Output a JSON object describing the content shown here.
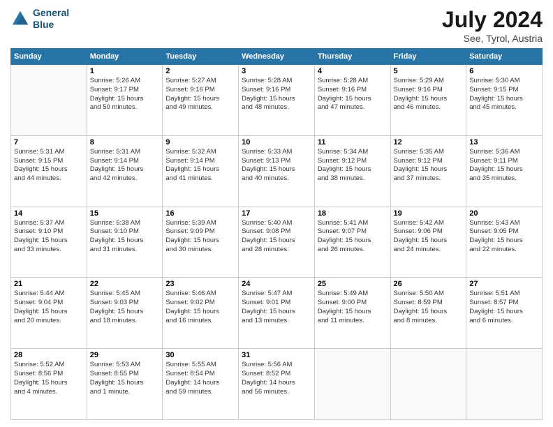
{
  "logo": {
    "line1": "General",
    "line2": "Blue"
  },
  "title": "July 2024",
  "subtitle": "See, Tyrol, Austria",
  "days_of_week": [
    "Sunday",
    "Monday",
    "Tuesday",
    "Wednesday",
    "Thursday",
    "Friday",
    "Saturday"
  ],
  "weeks": [
    [
      {
        "day": null,
        "info": null
      },
      {
        "day": "1",
        "info": "Sunrise: 5:26 AM\nSunset: 9:17 PM\nDaylight: 15 hours\nand 50 minutes."
      },
      {
        "day": "2",
        "info": "Sunrise: 5:27 AM\nSunset: 9:16 PM\nDaylight: 15 hours\nand 49 minutes."
      },
      {
        "day": "3",
        "info": "Sunrise: 5:28 AM\nSunset: 9:16 PM\nDaylight: 15 hours\nand 48 minutes."
      },
      {
        "day": "4",
        "info": "Sunrise: 5:28 AM\nSunset: 9:16 PM\nDaylight: 15 hours\nand 47 minutes."
      },
      {
        "day": "5",
        "info": "Sunrise: 5:29 AM\nSunset: 9:16 PM\nDaylight: 15 hours\nand 46 minutes."
      },
      {
        "day": "6",
        "info": "Sunrise: 5:30 AM\nSunset: 9:15 PM\nDaylight: 15 hours\nand 45 minutes."
      }
    ],
    [
      {
        "day": "7",
        "info": "Sunrise: 5:31 AM\nSunset: 9:15 PM\nDaylight: 15 hours\nand 44 minutes."
      },
      {
        "day": "8",
        "info": "Sunrise: 5:31 AM\nSunset: 9:14 PM\nDaylight: 15 hours\nand 42 minutes."
      },
      {
        "day": "9",
        "info": "Sunrise: 5:32 AM\nSunset: 9:14 PM\nDaylight: 15 hours\nand 41 minutes."
      },
      {
        "day": "10",
        "info": "Sunrise: 5:33 AM\nSunset: 9:13 PM\nDaylight: 15 hours\nand 40 minutes."
      },
      {
        "day": "11",
        "info": "Sunrise: 5:34 AM\nSunset: 9:12 PM\nDaylight: 15 hours\nand 38 minutes."
      },
      {
        "day": "12",
        "info": "Sunrise: 5:35 AM\nSunset: 9:12 PM\nDaylight: 15 hours\nand 37 minutes."
      },
      {
        "day": "13",
        "info": "Sunrise: 5:36 AM\nSunset: 9:11 PM\nDaylight: 15 hours\nand 35 minutes."
      }
    ],
    [
      {
        "day": "14",
        "info": "Sunrise: 5:37 AM\nSunset: 9:10 PM\nDaylight: 15 hours\nand 33 minutes."
      },
      {
        "day": "15",
        "info": "Sunrise: 5:38 AM\nSunset: 9:10 PM\nDaylight: 15 hours\nand 31 minutes."
      },
      {
        "day": "16",
        "info": "Sunrise: 5:39 AM\nSunset: 9:09 PM\nDaylight: 15 hours\nand 30 minutes."
      },
      {
        "day": "17",
        "info": "Sunrise: 5:40 AM\nSunset: 9:08 PM\nDaylight: 15 hours\nand 28 minutes."
      },
      {
        "day": "18",
        "info": "Sunrise: 5:41 AM\nSunset: 9:07 PM\nDaylight: 15 hours\nand 26 minutes."
      },
      {
        "day": "19",
        "info": "Sunrise: 5:42 AM\nSunset: 9:06 PM\nDaylight: 15 hours\nand 24 minutes."
      },
      {
        "day": "20",
        "info": "Sunrise: 5:43 AM\nSunset: 9:05 PM\nDaylight: 15 hours\nand 22 minutes."
      }
    ],
    [
      {
        "day": "21",
        "info": "Sunrise: 5:44 AM\nSunset: 9:04 PM\nDaylight: 15 hours\nand 20 minutes."
      },
      {
        "day": "22",
        "info": "Sunrise: 5:45 AM\nSunset: 9:03 PM\nDaylight: 15 hours\nand 18 minutes."
      },
      {
        "day": "23",
        "info": "Sunrise: 5:46 AM\nSunset: 9:02 PM\nDaylight: 15 hours\nand 16 minutes."
      },
      {
        "day": "24",
        "info": "Sunrise: 5:47 AM\nSunset: 9:01 PM\nDaylight: 15 hours\nand 13 minutes."
      },
      {
        "day": "25",
        "info": "Sunrise: 5:49 AM\nSunset: 9:00 PM\nDaylight: 15 hours\nand 11 minutes."
      },
      {
        "day": "26",
        "info": "Sunrise: 5:50 AM\nSunset: 8:59 PM\nDaylight: 15 hours\nand 8 minutes."
      },
      {
        "day": "27",
        "info": "Sunrise: 5:51 AM\nSunset: 8:57 PM\nDaylight: 15 hours\nand 6 minutes."
      }
    ],
    [
      {
        "day": "28",
        "info": "Sunrise: 5:52 AM\nSunset: 8:56 PM\nDaylight: 15 hours\nand 4 minutes."
      },
      {
        "day": "29",
        "info": "Sunrise: 5:53 AM\nSunset: 8:55 PM\nDaylight: 15 hours\nand 1 minute."
      },
      {
        "day": "30",
        "info": "Sunrise: 5:55 AM\nSunset: 8:54 PM\nDaylight: 14 hours\nand 59 minutes."
      },
      {
        "day": "31",
        "info": "Sunrise: 5:56 AM\nSunset: 8:52 PM\nDaylight: 14 hours\nand 56 minutes."
      },
      {
        "day": null,
        "info": null
      },
      {
        "day": null,
        "info": null
      },
      {
        "day": null,
        "info": null
      }
    ]
  ]
}
